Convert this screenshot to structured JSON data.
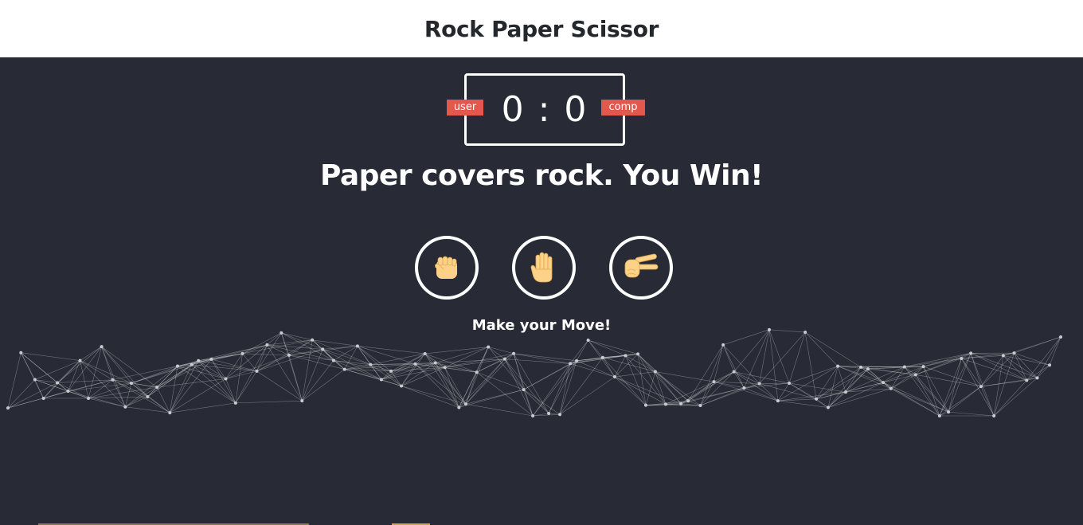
{
  "header": {
    "title": "Rock Paper Scissor"
  },
  "scoreboard": {
    "user_label": "user",
    "comp_label": "comp",
    "user_score": 0,
    "comp_score": 0,
    "display": "0 : 0"
  },
  "result": {
    "message": "Paper covers rock. You Win!"
  },
  "choices": [
    {
      "name": "rock",
      "icon": "fist-hand-icon"
    },
    {
      "name": "paper",
      "icon": "raised-hand-icon"
    },
    {
      "name": "scissors",
      "icon": "victory-hand-icon"
    }
  ],
  "prompt": {
    "text": "Make your Move!"
  },
  "colors": {
    "background": "#282a35",
    "header_bg": "#ffffff",
    "badge": "#e2584d",
    "hand_skin": "#fbd288"
  }
}
